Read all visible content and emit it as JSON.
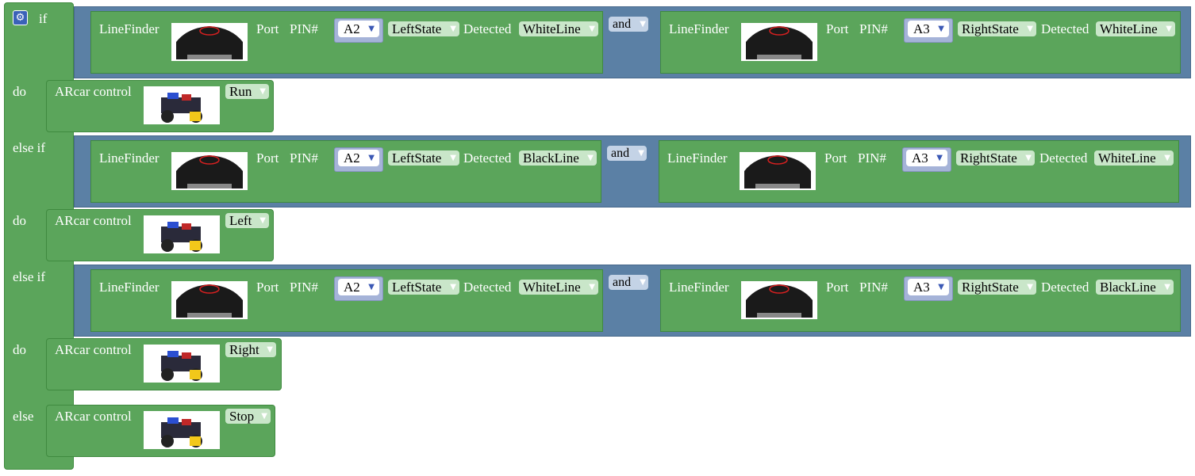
{
  "if_block": {
    "clauses": [
      {
        "keyword": "if",
        "left": {
          "label": "LineFinder",
          "port": "Port",
          "pin_label": "PIN#",
          "pin": "A2",
          "state": "LeftState",
          "detected": "Detected",
          "line": "WhiteLine"
        },
        "op": "and",
        "right": {
          "label": "LineFinder",
          "port": "Port",
          "pin_label": "PIN#",
          "pin": "A3",
          "state": "RightState",
          "detected": "Detected",
          "line": "WhiteLine"
        },
        "do": "do",
        "action_label": "ARcar control",
        "action": "Run"
      },
      {
        "keyword": "else if",
        "left": {
          "label": "LineFinder",
          "port": "Port",
          "pin_label": "PIN#",
          "pin": "A2",
          "state": "LeftState",
          "detected": "Detected",
          "line": "BlackLine"
        },
        "op": "and",
        "right": {
          "label": "LineFinder",
          "port": "Port",
          "pin_label": "PIN#",
          "pin": "A3",
          "state": "RightState",
          "detected": "Detected",
          "line": "WhiteLine"
        },
        "do": "do",
        "action_label": "ARcar control",
        "action": "Left"
      },
      {
        "keyword": "else if",
        "left": {
          "label": "LineFinder",
          "port": "Port",
          "pin_label": "PIN#",
          "pin": "A2",
          "state": "LeftState",
          "detected": "Detected",
          "line": "WhiteLine"
        },
        "op": "and",
        "right": {
          "label": "LineFinder",
          "port": "Port",
          "pin_label": "PIN#",
          "pin": "A3",
          "state": "RightState",
          "detected": "Detected",
          "line": "BlackLine"
        },
        "do": "do",
        "action_label": "ARcar control",
        "action": "Right"
      }
    ],
    "else": {
      "keyword": "else",
      "action_label": "ARcar control",
      "action": "Stop"
    }
  },
  "icons": {
    "gear": "gear-icon",
    "dropdown": "triangle-down-icon"
  },
  "colors": {
    "logic_green": "#5ba55b",
    "logic_blue": "#5b80a5",
    "pin_block": "#a5b3d8",
    "dropdown_bg": "#c9e6c9"
  }
}
